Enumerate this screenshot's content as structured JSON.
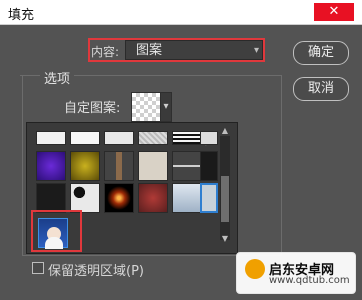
{
  "window": {
    "title": "填充",
    "close_symbol": "✕"
  },
  "content": {
    "label": "内容:",
    "selected": "图案"
  },
  "buttons": {
    "ok": "确定",
    "cancel": "取消"
  },
  "options": {
    "group_label": "选项",
    "custom_pattern_label": "自定图案:"
  },
  "checkbox": {
    "preserve_transparency": "保留透明区域(P)"
  },
  "brand": {
    "name": "启东安卓网",
    "url": "www.qdtub.com"
  },
  "icons": {
    "gear": "gear-icon",
    "chevron": "chevron-down-icon"
  },
  "colors": {
    "dialog_bg": "#535353",
    "highlight_red": "#e0383c",
    "selection_blue": "#3d8fe6"
  }
}
